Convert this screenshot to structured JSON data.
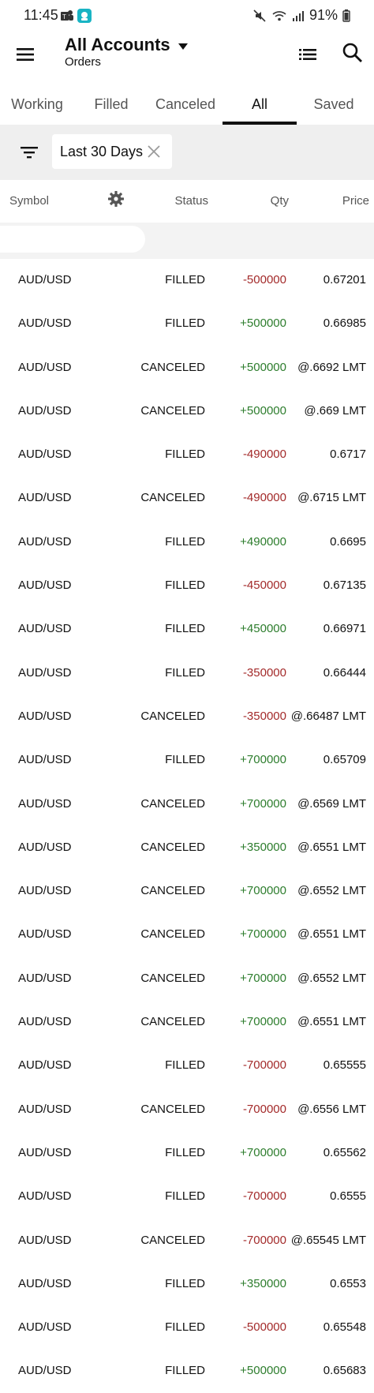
{
  "status_bar": {
    "time": "11:45",
    "battery": "91%",
    "icons": [
      "teams-app-icon",
      "app-icon",
      "mute-icon",
      "wifi-icon",
      "signal-icon",
      "battery-icon"
    ]
  },
  "app_bar": {
    "title": "All Accounts",
    "subtitle": "Orders",
    "icons": [
      "menu-icon",
      "dropdown-icon",
      "list-icon",
      "search-icon"
    ]
  },
  "tabs": [
    {
      "label": "Working",
      "active": false
    },
    {
      "label": "Filled",
      "active": false
    },
    {
      "label": "Canceled",
      "active": false
    },
    {
      "label": "All",
      "active": true
    },
    {
      "label": "Saved",
      "active": false
    }
  ],
  "filter": {
    "chip_label": "Last 30 Days"
  },
  "columns": {
    "symbol": "Symbol",
    "status": "Status",
    "qty": "Qty",
    "price": "Price"
  },
  "colors": {
    "positive": "#2d7d2d",
    "negative": "#a32a2a",
    "active_tab": "#111111"
  },
  "orders": [
    {
      "symbol": "AUD/USD",
      "status": "FILLED",
      "qty": "-500000",
      "price": "0.67201"
    },
    {
      "symbol": "AUD/USD",
      "status": "FILLED",
      "qty": "+500000",
      "price": "0.66985"
    },
    {
      "symbol": "AUD/USD",
      "status": "CANCELED",
      "qty": "+500000",
      "price": "@.6692 LMT"
    },
    {
      "symbol": "AUD/USD",
      "status": "CANCELED",
      "qty": "+500000",
      "price": "@.669 LMT"
    },
    {
      "symbol": "AUD/USD",
      "status": "FILLED",
      "qty": "-490000",
      "price": "0.6717"
    },
    {
      "symbol": "AUD/USD",
      "status": "CANCELED",
      "qty": "-490000",
      "price": "@.6715 LMT"
    },
    {
      "symbol": "AUD/USD",
      "status": "FILLED",
      "qty": "+490000",
      "price": "0.6695"
    },
    {
      "symbol": "AUD/USD",
      "status": "FILLED",
      "qty": "-450000",
      "price": "0.67135"
    },
    {
      "symbol": "AUD/USD",
      "status": "FILLED",
      "qty": "+450000",
      "price": "0.66971"
    },
    {
      "symbol": "AUD/USD",
      "status": "FILLED",
      "qty": "-350000",
      "price": "0.66444"
    },
    {
      "symbol": "AUD/USD",
      "status": "CANCELED",
      "qty": "-350000",
      "price": "@.66487 LMT"
    },
    {
      "symbol": "AUD/USD",
      "status": "FILLED",
      "qty": "+700000",
      "price": "0.65709"
    },
    {
      "symbol": "AUD/USD",
      "status": "CANCELED",
      "qty": "+700000",
      "price": "@.6569 LMT"
    },
    {
      "symbol": "AUD/USD",
      "status": "CANCELED",
      "qty": "+350000",
      "price": "@.6551 LMT"
    },
    {
      "symbol": "AUD/USD",
      "status": "CANCELED",
      "qty": "+700000",
      "price": "@.6552 LMT"
    },
    {
      "symbol": "AUD/USD",
      "status": "CANCELED",
      "qty": "+700000",
      "price": "@.6551 LMT"
    },
    {
      "symbol": "AUD/USD",
      "status": "CANCELED",
      "qty": "+700000",
      "price": "@.6552 LMT"
    },
    {
      "symbol": "AUD/USD",
      "status": "CANCELED",
      "qty": "+700000",
      "price": "@.6551 LMT"
    },
    {
      "symbol": "AUD/USD",
      "status": "FILLED",
      "qty": "-700000",
      "price": "0.65555"
    },
    {
      "symbol": "AUD/USD",
      "status": "CANCELED",
      "qty": "-700000",
      "price": "@.6556 LMT"
    },
    {
      "symbol": "AUD/USD",
      "status": "FILLED",
      "qty": "+700000",
      "price": "0.65562"
    },
    {
      "symbol": "AUD/USD",
      "status": "FILLED",
      "qty": "-700000",
      "price": "0.6555"
    },
    {
      "symbol": "AUD/USD",
      "status": "CANCELED",
      "qty": "-700000",
      "price": "@.65545 LMT"
    },
    {
      "symbol": "AUD/USD",
      "status": "FILLED",
      "qty": "+350000",
      "price": "0.6553"
    },
    {
      "symbol": "AUD/USD",
      "status": "FILLED",
      "qty": "-500000",
      "price": "0.65548"
    },
    {
      "symbol": "AUD/USD",
      "status": "FILLED",
      "qty": "+500000",
      "price": "0.65683"
    }
  ]
}
